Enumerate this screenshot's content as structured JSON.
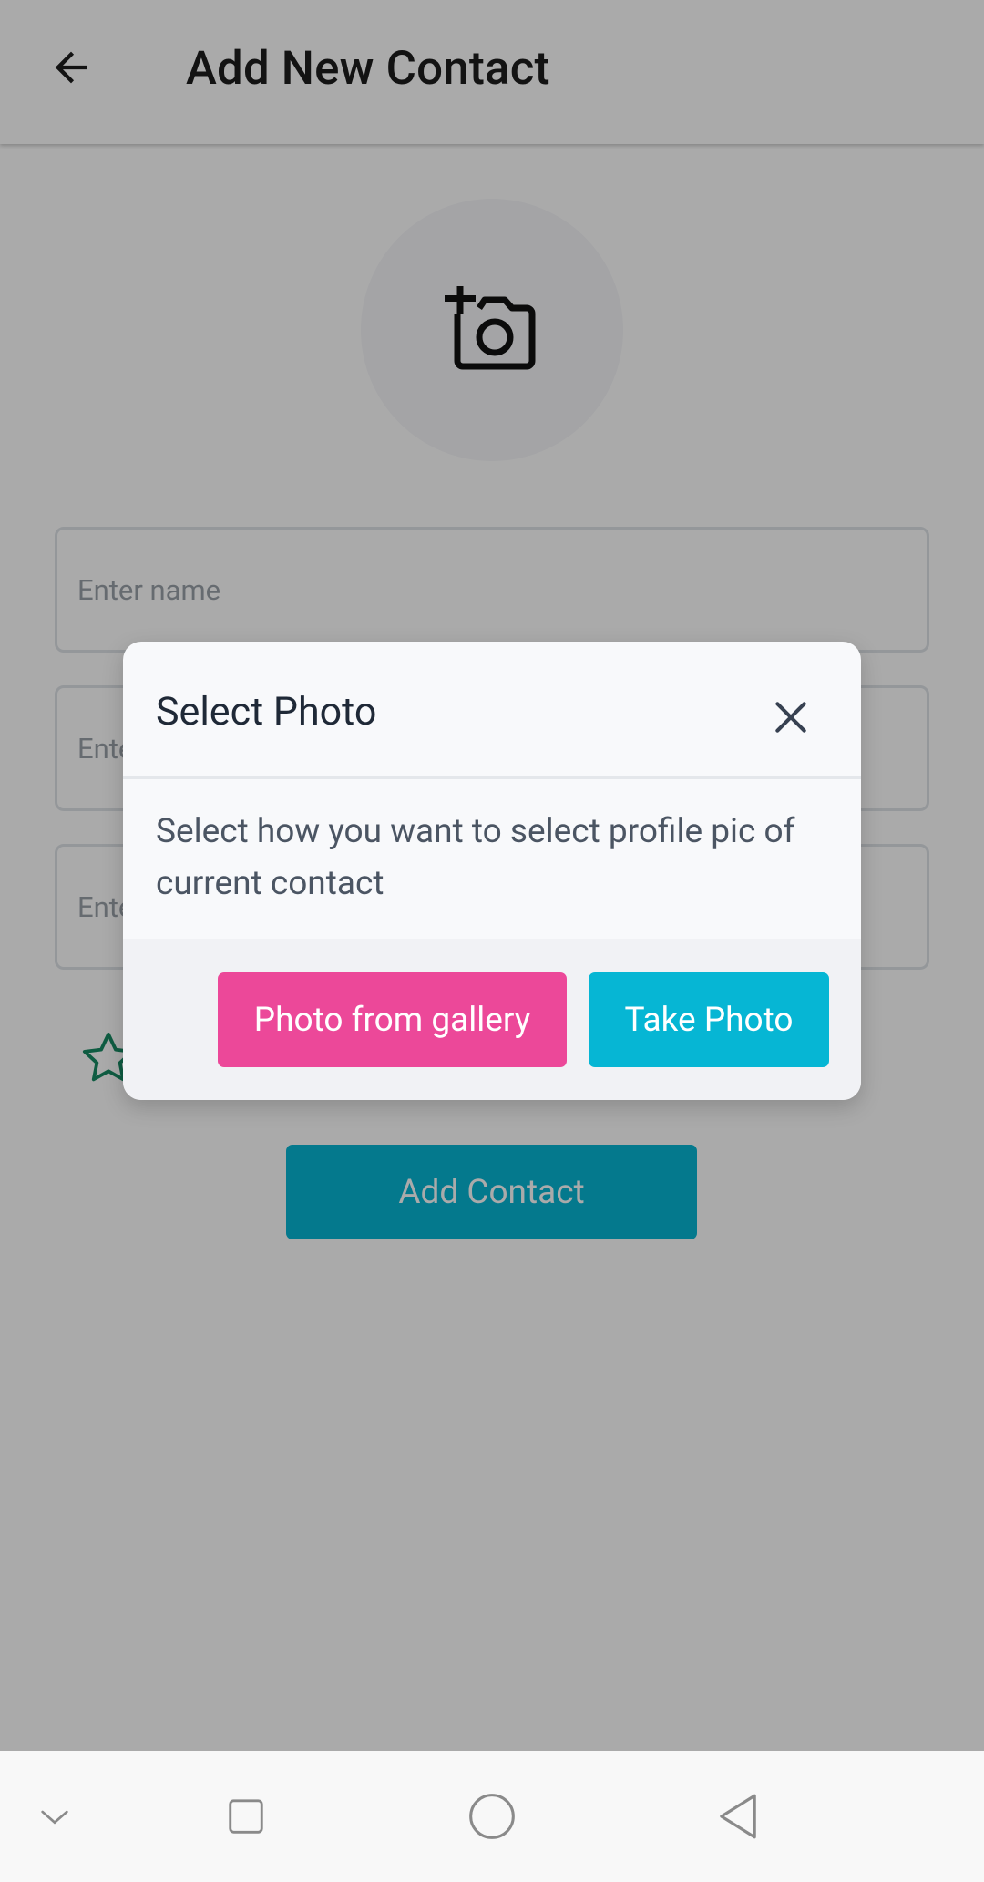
{
  "app_bar": {
    "title": "Add New Contact",
    "back_icon": "arrow-left-icon"
  },
  "form": {
    "avatar_icon": "add-photo-camera-icon",
    "name_placeholder": "Enter name",
    "field2_placeholder": "Ente",
    "field3_placeholder": "Ente",
    "favorite_icon": "star-outline-icon",
    "add_contact_label": "Add Contact"
  },
  "modal": {
    "title": "Select Photo",
    "close_icon": "close-icon",
    "message": "Select how you want to select profile pic of current contact",
    "gallery_label": "Photo from gallery",
    "take_photo_label": "Take Photo"
  },
  "nav_bar": {
    "icons": [
      "chevron-down-icon",
      "square-recents-icon",
      "circle-home-icon",
      "triangle-back-icon"
    ]
  },
  "colors": {
    "accent_cyan": "#06b6d4",
    "accent_pink": "#ec4899",
    "star_green": "#178a63"
  }
}
